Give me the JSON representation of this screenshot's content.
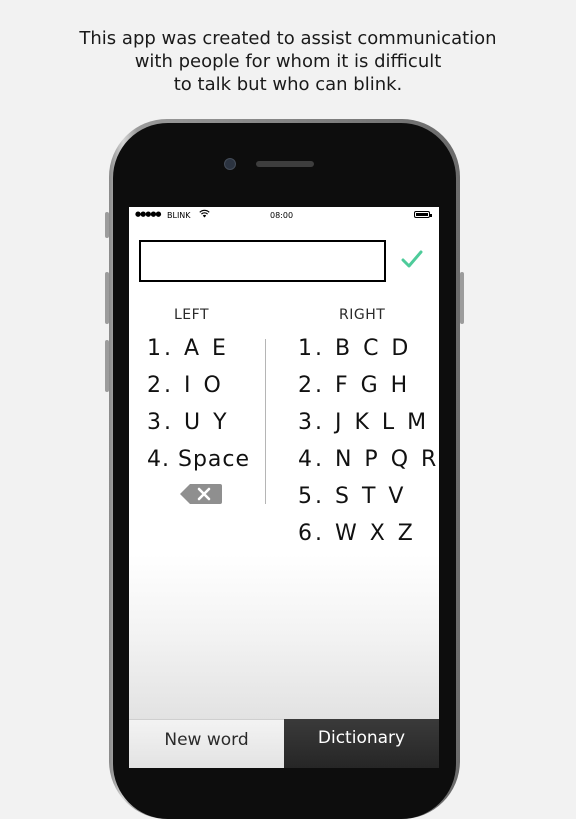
{
  "caption": {
    "line1": "This app was created to assist communication",
    "line2": "with people for whom it is difficult",
    "line3": "to talk but who can blink."
  },
  "status_bar": {
    "signal": "●●●●●",
    "carrier": "BLINK",
    "wifi_icon": "wifi-icon",
    "time": "08:00",
    "battery_icon": "battery-icon"
  },
  "text_input": {
    "value": "",
    "placeholder": ""
  },
  "confirm_icon": "checkmark-icon",
  "accent_color": "#4ecb9a",
  "left": {
    "header": "LEFT",
    "rows": [
      "1. A E",
      "2.  I O",
      "3. U Y",
      "4. Space"
    ],
    "backspace_icon": "backspace-icon"
  },
  "right": {
    "header": "RIGHT",
    "rows": [
      "1. B C D",
      "2. F G H",
      "3. J K L M",
      "4. N P Q R",
      "5. S T V",
      "6. W X Z"
    ]
  },
  "bottom_bar": {
    "new_word": "New word",
    "dictionary": "Dictionary"
  }
}
